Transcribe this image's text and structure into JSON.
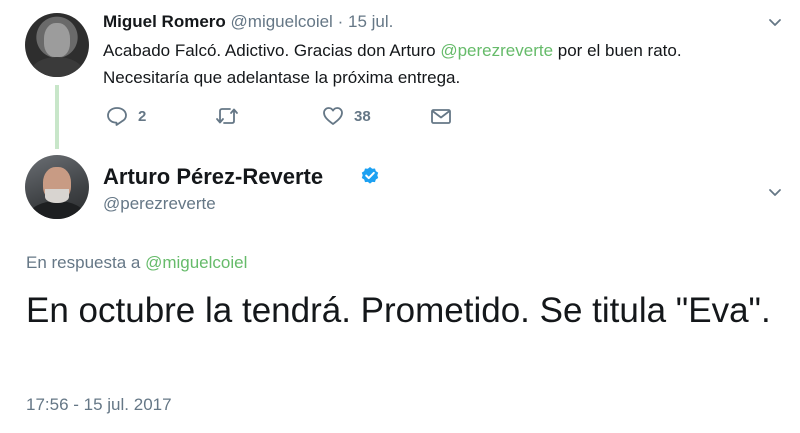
{
  "reply_tweet": {
    "author_name": "Miguel Romero",
    "author_handle": "@miguelcoiel",
    "separator": "·",
    "date": "15 jul.",
    "text_before": "Acabado Falcó. Adictivo. Gracias don Arturo ",
    "text_mention": "@perezreverte",
    "text_after": " por el buen rato. Necesitaría que adelantase la próxima entrega.",
    "actions": {
      "reply_count": "2",
      "retweet_count": "",
      "like_count": "38"
    },
    "icons": [
      "reply-icon",
      "retweet-icon",
      "like-icon",
      "message-icon",
      "chevron-down-icon"
    ]
  },
  "main_tweet": {
    "author_name": "Arturo Pérez-Reverte",
    "author_handle": "@perezreverte",
    "verified": true,
    "reply_prefix": "En respuesta a ",
    "reply_mention": "@miguelcoiel",
    "text": "En octubre la tendrá. Prometido. Se titula \"Eva\".",
    "timestamp": "17:56 - 15 jul. 2017"
  },
  "colors": {
    "accent": "#66bb6a",
    "thread_line": "#c8e6c9",
    "muted": "#657786",
    "verified": "#1da1f2",
    "text": "#14171a"
  }
}
